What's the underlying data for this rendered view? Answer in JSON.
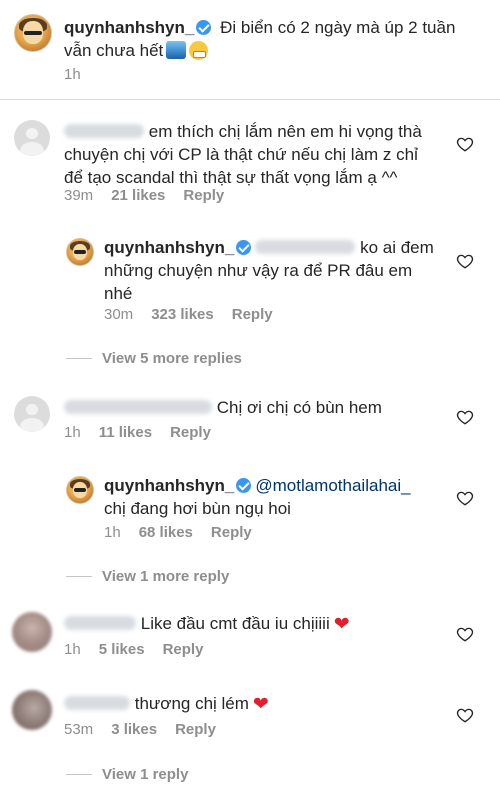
{
  "caption": {
    "username": "quynhanhshyn_",
    "text_line1": "Đi biển có 2 ngày mà úp 2 tuần",
    "text_line2": "vẫn chưa hết",
    "time": "1h"
  },
  "comments": [
    {
      "text_line1": "em thích chị lắm nên em hi vọng thà",
      "text_line2": "chuyện chị với CP là thật chứ nếu chị làm z chỉ",
      "text_line3": "để tạo scandal thì thật sự thất vọng lắm ạ ^^",
      "time": "39m",
      "likes": "21 likes",
      "reply": "Reply"
    },
    {
      "username": "quynhanhshyn_",
      "text_line1": "ko ai đem",
      "text_line2": "những chuyện như vậy ra để PR đâu em",
      "text_line3": "nhé",
      "time": "30m",
      "likes": "323 likes",
      "reply": "Reply"
    },
    {
      "text": "Chị ơi chị có bùn hem",
      "time": "1h",
      "likes": "11 likes",
      "reply": "Reply"
    },
    {
      "username": "quynhanhshyn_",
      "mention": "@motlamothailahai_",
      "text": "chị đang hơi bùn ngụ hoi",
      "time": "1h",
      "likes": "68 likes",
      "reply": "Reply"
    },
    {
      "text": "Like đầu cmt đầu iu chịiiii",
      "time": "1h",
      "likes": "5 likes",
      "reply": "Reply"
    },
    {
      "text": "thương chị lém",
      "time": "53m",
      "likes": "3 likes",
      "reply": "Reply"
    }
  ],
  "view_more": {
    "first": "View 5 more replies",
    "second": "View 1 more reply",
    "third": "View 1 reply"
  },
  "icons": {
    "like": "heart-outline-icon",
    "verified": "verified-badge-icon"
  },
  "colors": {
    "verified": "#3897f0",
    "mention": "#003569",
    "secondary_text": "#8e8e8e"
  }
}
